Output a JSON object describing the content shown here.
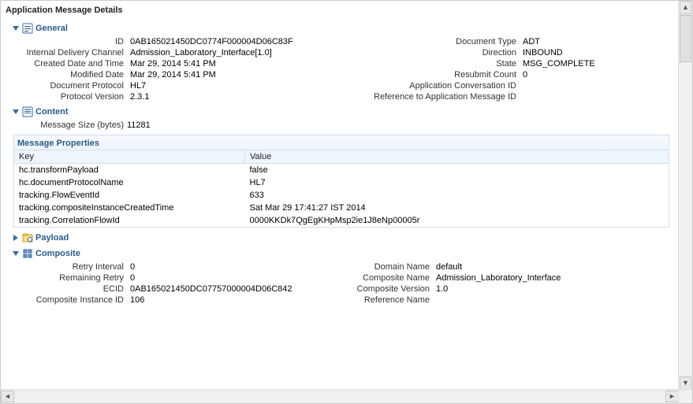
{
  "title": "Application Message Details",
  "sections": {
    "general": {
      "title": "General",
      "left": [
        {
          "label": "ID",
          "value": "0AB165021450DC0774F000004D06C83F"
        },
        {
          "label": "Internal Delivery Channel",
          "value": "Admission_Laboratory_Interface[1.0]"
        },
        {
          "label": "Created Date and Time",
          "value": "Mar 29, 2014 5:41 PM"
        },
        {
          "label": "Modified Date",
          "value": "Mar 29, 2014 5:41 PM"
        },
        {
          "label": "Document Protocol",
          "value": "HL7"
        },
        {
          "label": "Protocol Version",
          "value": "2.3.1"
        }
      ],
      "right": [
        {
          "label": "Document Type",
          "value": "ADT"
        },
        {
          "label": "Direction",
          "value": "INBOUND"
        },
        {
          "label": "State",
          "value": "MSG_COMPLETE"
        },
        {
          "label": "Resubmit Count",
          "value": "0"
        },
        {
          "label": "Application Conversation ID",
          "value": ""
        },
        {
          "label": "Reference to Application Message ID",
          "value": ""
        }
      ]
    },
    "content": {
      "title": "Content",
      "size_label": "Message Size (bytes)",
      "size_value": "11281",
      "props_title": "Message Properties",
      "columns": {
        "key": "Key",
        "value": "Value"
      },
      "rows": [
        {
          "key": "hc.transformPayload",
          "value": "false"
        },
        {
          "key": "hc.documentProtocolName",
          "value": "HL7"
        },
        {
          "key": "tracking.FlowEventId",
          "value": "633"
        },
        {
          "key": "tracking.compositeInstanceCreatedTime",
          "value": "Sat Mar 29 17:41:27 IST 2014"
        },
        {
          "key": "tracking.CorrelationFlowId",
          "value": "0000KKDk7QgEgKHpMsp2ie1J8eNp00005r"
        }
      ]
    },
    "payload": {
      "title": "Payload"
    },
    "composite": {
      "title": "Composite",
      "left": [
        {
          "label": "Retry Interval",
          "value": "0"
        },
        {
          "label": "Remaining Retry",
          "value": "0"
        },
        {
          "label": "ECID",
          "value": "0AB165021450DC07757000004D06C842"
        },
        {
          "label": "Composite Instance ID",
          "value": "106"
        }
      ],
      "right": [
        {
          "label": "Domain Name",
          "value": "default"
        },
        {
          "label": "Composite Name",
          "value": "Admission_Laboratory_Interface"
        },
        {
          "label": "Composite Version",
          "value": "1.0"
        },
        {
          "label": "Reference Name",
          "value": ""
        }
      ]
    }
  }
}
